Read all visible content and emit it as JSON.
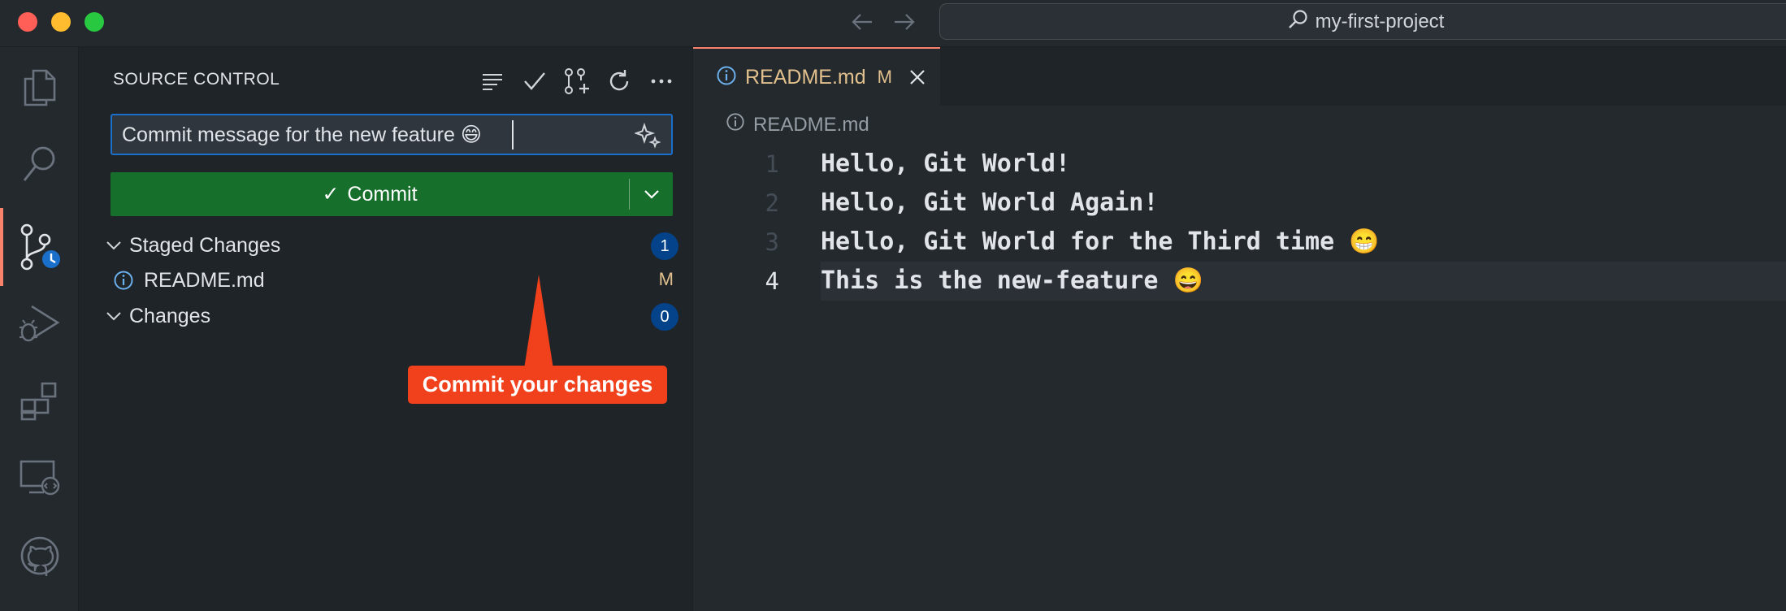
{
  "window": {
    "search_label": "my-first-project"
  },
  "sidebar": {
    "title": "SOURCE CONTROL",
    "commit_message": "Commit message for the new feature 😄",
    "commit_label": "Commit",
    "commit_check": "✓",
    "groups": [
      {
        "label": "Staged Changes",
        "count": "1"
      },
      {
        "label": "Changes",
        "count": "0"
      }
    ],
    "staged_files": [
      {
        "name": "README.md",
        "status": "M"
      }
    ]
  },
  "callout": {
    "text": "Commit your changes"
  },
  "editor": {
    "tab": {
      "label": "README.md",
      "status": "M"
    },
    "breadcrumb": "README.md",
    "lines": [
      {
        "number": "1",
        "text": "Hello, Git World!"
      },
      {
        "number": "2",
        "text": "Hello, Git World Again!"
      },
      {
        "number": "3",
        "text": "Hello, Git World for the Third time 😁"
      },
      {
        "number": "4",
        "text": "This is the new-feature 😄"
      }
    ],
    "current_line": 4
  },
  "colors": {
    "accent": "#f9826c",
    "commit_button": "#176f2c",
    "input_border": "#1a6fcb",
    "badge": "#044289",
    "modified": "#e2c08d",
    "callout": "#f0401c"
  },
  "icons": {
    "activity": [
      "explorer-icon",
      "search-icon",
      "source-control-icon",
      "run-debug-icon",
      "extensions-icon",
      "remote-explorer-icon",
      "github-icon"
    ],
    "sidebar_actions": [
      "view-as-list-icon",
      "commit-check-icon",
      "create-pull-request-icon",
      "refresh-icon",
      "more-actions-icon"
    ]
  }
}
